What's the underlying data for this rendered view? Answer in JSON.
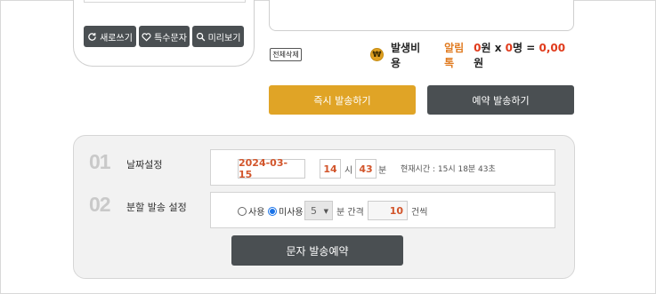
{
  "phone": {
    "buttons": [
      {
        "label": "새로쓰기",
        "icon": "refresh-icon"
      },
      {
        "label": "특수문자",
        "icon": "heart-icon"
      },
      {
        "label": "미리보기",
        "icon": "search-icon"
      }
    ]
  },
  "clear_all_label": "전체삭제",
  "cost": {
    "label": "발생비용",
    "type": "알림톡",
    "amount": "0",
    "amount_unit": "원 x ",
    "count": "0",
    "count_unit": "명 = ",
    "total": "0,00",
    "total_unit": "원",
    "icon": "won-coin-icon"
  },
  "actions": {
    "send_now": "즉시 발송하기",
    "send_reserve": "예약 발송하기"
  },
  "reservation": {
    "step1": {
      "num": "01",
      "label": "날짜설정",
      "date": "2024-03-15",
      "hour": "14",
      "hour_unit": "시",
      "minute": "43",
      "minute_unit": "분",
      "current_time": "현재시간 : 15시 18분 43초"
    },
    "step2": {
      "num": "02",
      "label": "분할 발송 설정",
      "radio_use": "사용",
      "radio_nouse": "미사용",
      "selected": "미사용",
      "interval": "5",
      "interval_unit": "분 간격",
      "count": "10",
      "count_unit": "건씩"
    },
    "submit": "문자 발송예약"
  },
  "colors": {
    "accent": "#e0a426",
    "dark_button": "#4a4f52",
    "value_red": "#d2552b",
    "label_orange": "#e07a1f"
  }
}
